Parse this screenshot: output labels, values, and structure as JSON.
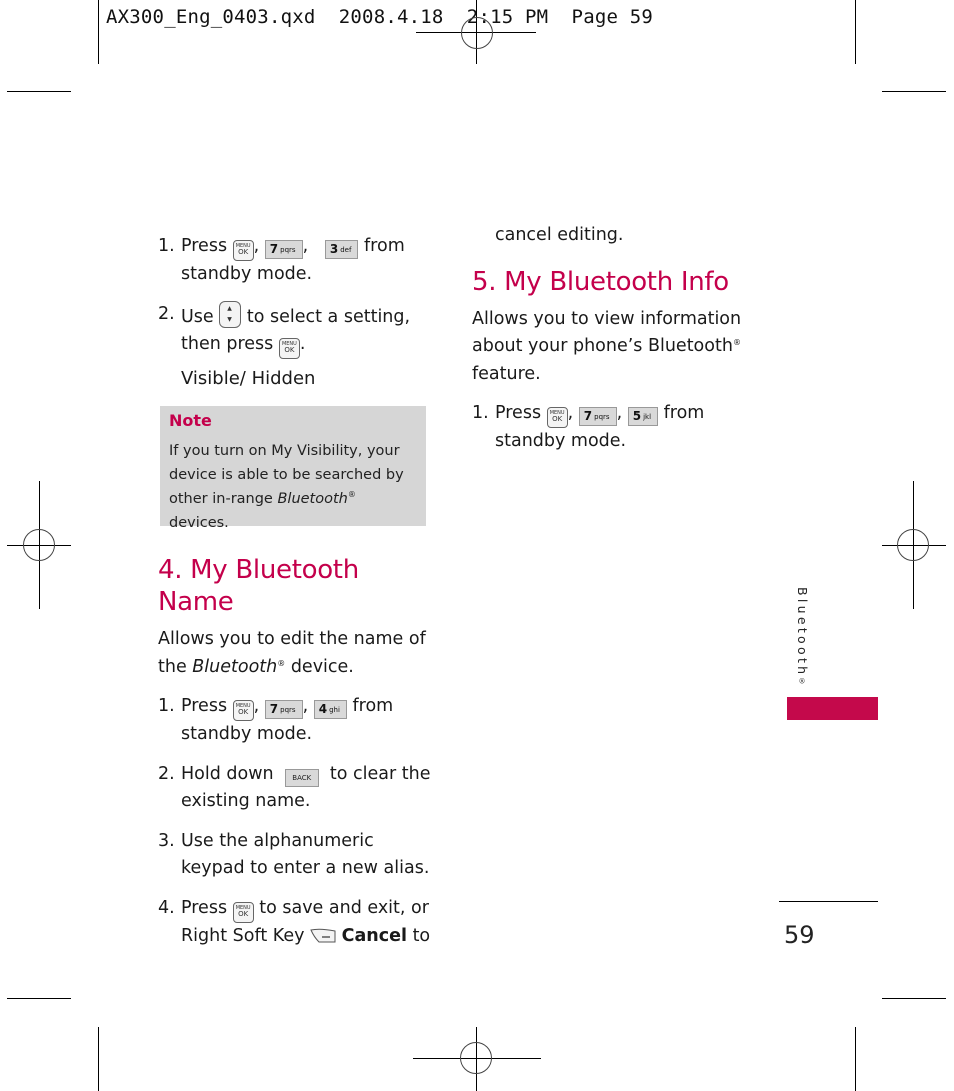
{
  "slug_line": "AX300_Eng_0403.qxd  2008.4.18  2:15 PM  Page 59",
  "colors": {
    "accent": "#c4004b",
    "note_bg": "#d6d6d6",
    "tab_bar": "#c4094b"
  },
  "icons": {
    "menu_ok": {
      "name": "menu-ok-key-icon",
      "top": "MENU",
      "bottom": "OK"
    },
    "key7": {
      "name": "key-7-icon",
      "digit": "7",
      "letters": "pqrs"
    },
    "key3": {
      "name": "key-3-icon",
      "digit": "3",
      "letters": "def"
    },
    "key4": {
      "name": "key-4-icon",
      "digit": "4",
      "letters": "ghi"
    },
    "key5": {
      "name": "key-5-icon",
      "digit": "5",
      "letters": "jkl"
    },
    "nav_up": "▲",
    "nav_down": "▼",
    "back": "BACK"
  },
  "left_column": {
    "intro_steps": [
      {
        "num": "1.",
        "pre": "Press",
        "sep1": ",",
        "sep2": ",",
        "post": "from standby mode."
      },
      {
        "num": "2.",
        "pre": "Use",
        "mid": "to select a setting, then press",
        "post": "."
      }
    ],
    "options": "Visible/ Hidden",
    "note": {
      "title": "Note",
      "text_before": "If you turn on My Visibility, your device is able to be searched by other in-range ",
      "text_italic": "Bluetooth",
      "reg": "®",
      "text_after": " devices."
    },
    "section4": {
      "heading": "4. My Bluetooth Name",
      "desc_before": "Allows you to edit the name of the ",
      "desc_italic": "Bluetooth",
      "reg": "®",
      "desc_after": " device.",
      "steps": [
        {
          "num": "1.",
          "pre": "Press",
          "sep1": ",",
          "sep2": ",",
          "post": "from standby mode."
        },
        {
          "num": "2.",
          "pre": "Hold down",
          "post": "to clear the existing name."
        },
        {
          "num": "3.",
          "text": "Use the alphanumeric keypad to enter a new alias."
        },
        {
          "num": "4.",
          "pre": "Press",
          "mid": "to save and exit, or Right Soft Key",
          "bold": "Cancel",
          "post": "to"
        }
      ]
    }
  },
  "right_column": {
    "continued": "cancel editing.",
    "section5": {
      "heading": "5. My Bluetooth Info",
      "desc": "Allows you to view information about your phone’s Bluetooth",
      "reg": "®",
      "desc_after": " feature.",
      "steps": [
        {
          "num": "1.",
          "pre": "Press",
          "sep1": ",",
          "sep2": ",",
          "post": "from standby mode."
        }
      ]
    }
  },
  "side_tab": {
    "label": "Bluetooth",
    "reg": "®"
  },
  "page_number": "59"
}
